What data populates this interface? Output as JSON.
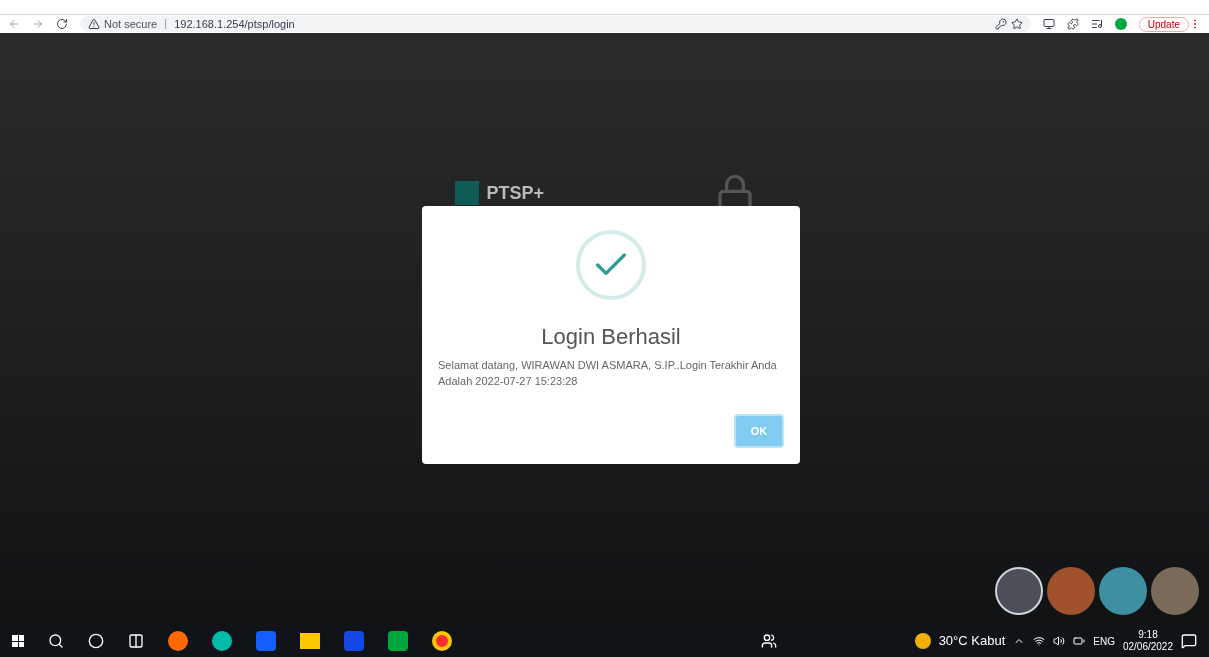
{
  "browser": {
    "security": "Not secure",
    "url": "192.168.1.254/ptsp/login",
    "update_button": "Update"
  },
  "login_page": {
    "logo_text": "PTSP+"
  },
  "dialog": {
    "title": "Login Berhasil",
    "message": "Selamat datang, WIRAWAN DWI ASMARA, S.IP..Login Terakhir Anda Adalah 2022-07-27 15:23:28",
    "button": "OK"
  },
  "wallpapers": [
    {
      "selected": true,
      "color": "#4a4f58"
    },
    {
      "selected": false,
      "color": "#a0522d"
    },
    {
      "selected": false,
      "color": "#3f8fa3"
    },
    {
      "selected": false,
      "color": "#7a6a5a"
    }
  ],
  "taskbar": {
    "weather": "30°C Kabut",
    "language": "ENG",
    "time": "9:18",
    "date": "02/06/2022"
  }
}
